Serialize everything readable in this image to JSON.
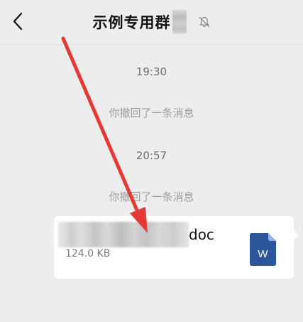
{
  "header": {
    "back_label": "<",
    "title": "示例专用群"
  },
  "messages": [
    {
      "type": "time",
      "text": "19:30"
    },
    {
      "type": "system",
      "text": "你撤回了一条消息"
    },
    {
      "type": "time",
      "text": "20:57"
    },
    {
      "type": "system",
      "text": "你撤回了一条消息"
    }
  ],
  "file_message": {
    "name_suffix": "doc",
    "size": "124.0 KB",
    "icon_letter": "W"
  },
  "colors": {
    "background": "#ededed",
    "card": "#ffffff",
    "word_blue": "#2b579a",
    "annotation_red": "#e53935"
  },
  "icons": {
    "back": "chevron-left-icon",
    "mute": "bell-off-icon",
    "file": "word-document-icon"
  }
}
